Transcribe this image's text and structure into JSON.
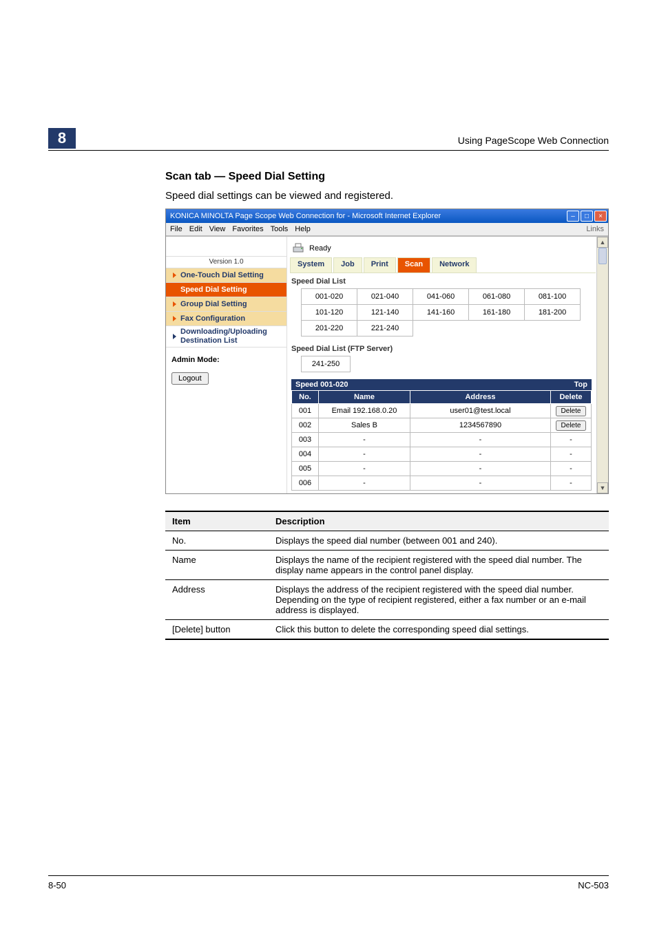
{
  "chapter_num": "8",
  "header_right": "Using PageScope Web Connection",
  "section_heading": "Scan tab — Speed Dial Setting",
  "section_lead": "Speed dial settings can be viewed and registered.",
  "win": {
    "title": "KONICA MINOLTA Page Scope Web Connection for        - Microsoft Internet Explorer",
    "menu": {
      "file": "File",
      "edit": "Edit",
      "view": "View",
      "favorites": "Favorites",
      "tools": "Tools",
      "help": "Help",
      "links": "Links"
    }
  },
  "sidebar": {
    "version": "Version 1.0",
    "items": [
      {
        "label": "One-Touch Dial Setting",
        "sel": false,
        "light": true
      },
      {
        "label": "Speed Dial Setting",
        "sel": true,
        "light": false
      },
      {
        "label": "Group Dial Setting",
        "sel": false,
        "light": true
      },
      {
        "label": "Fax Configuration",
        "sel": false,
        "light": true
      },
      {
        "label": "Downloading/Uploading Destination List",
        "sel": false,
        "light": false
      }
    ],
    "admin": "Admin Mode:",
    "logout": "Logout"
  },
  "main": {
    "status": "Ready",
    "tabs": [
      "System",
      "Job",
      "Print",
      "Scan",
      "Network"
    ],
    "active_tab": 3,
    "list_title": "Speed Dial List",
    "ranges": [
      [
        "001-020",
        "021-040",
        "041-060",
        "061-080",
        "081-100"
      ],
      [
        "101-120",
        "121-140",
        "141-160",
        "161-180",
        "181-200"
      ],
      [
        "201-220",
        "221-240"
      ]
    ],
    "ftp_title": "Speed Dial List (FTP Server)",
    "ftp_ranges": [
      [
        "241-250"
      ]
    ],
    "group_header": {
      "left": "Speed 001-020",
      "right": "Top"
    },
    "cols": {
      "no": "No.",
      "name": "Name",
      "addr": "Address",
      "del": "Delete"
    },
    "rows": [
      {
        "no": "001",
        "name": "Email 192.168.0.20",
        "addr": "user01@test.local",
        "del": "Delete"
      },
      {
        "no": "002",
        "name": "Sales B",
        "addr": "1234567890",
        "del": "Delete"
      },
      {
        "no": "003",
        "name": "-",
        "addr": "-",
        "del": "-"
      },
      {
        "no": "004",
        "name": "-",
        "addr": "-",
        "del": "-"
      },
      {
        "no": "005",
        "name": "-",
        "addr": "-",
        "del": "-"
      },
      {
        "no": "006",
        "name": "-",
        "addr": "-",
        "del": "-"
      }
    ]
  },
  "desc": {
    "col_item": "Item",
    "col_desc": "Description",
    "rows": [
      {
        "k": "No.",
        "v": "Displays the speed dial number (between 001 and 240)."
      },
      {
        "k": "Name",
        "v": "Displays the name of the recipient registered with the speed dial number. The display name appears in the control panel display."
      },
      {
        "k": "Address",
        "v": "Displays the address of the recipient registered with the speed dial number.\nDepending on the type of recipient registered, either a fax number or an e-mail address is displayed."
      },
      {
        "k": "[Delete] button",
        "v": "Click this button to delete the corresponding speed dial settings."
      }
    ]
  },
  "footer": {
    "left": "8-50",
    "right": "NC-503"
  }
}
